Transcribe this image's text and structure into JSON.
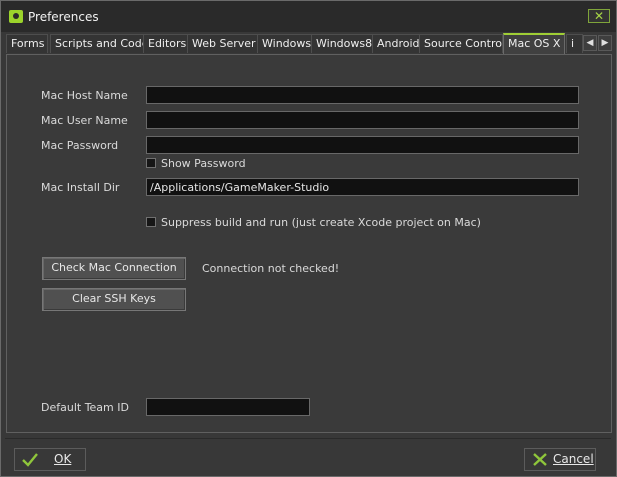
{
  "window": {
    "title": "Preferences",
    "close_glyph": "✕"
  },
  "tabs": [
    {
      "label": "Forms"
    },
    {
      "label": "Scripts and Code"
    },
    {
      "label": "Editors"
    },
    {
      "label": "Web Server"
    },
    {
      "label": "Windows"
    },
    {
      "label": "Windows8"
    },
    {
      "label": "Android"
    },
    {
      "label": "Source Control"
    },
    {
      "label": "Mac OS X"
    },
    {
      "label": "i"
    }
  ],
  "active_tab": "Mac OS X",
  "tab_scroll": {
    "left": "◀",
    "right": "▶"
  },
  "form": {
    "host_label": "Mac Host Name",
    "host_value": "",
    "user_label": "Mac User Name",
    "user_value": "",
    "password_label": "Mac Password",
    "password_value": "",
    "show_password_label": "Show Password",
    "show_password_checked": false,
    "install_dir_label": "Mac Install Dir",
    "install_dir_value": "/Applications/GameMaker-Studio",
    "suppress_label": "Suppress build and run (just create Xcode project on Mac)",
    "suppress_checked": false,
    "check_connection_label": "Check Mac Connection",
    "connection_status": "Connection not checked!",
    "clear_ssh_label": "Clear SSH Keys",
    "team_id_label": "Default Team ID",
    "team_id_value": ""
  },
  "footer": {
    "ok_label": "OK",
    "cancel_label": "Cancel"
  },
  "colors": {
    "accent": "#9fce35",
    "cancel_x": "#8fc63b"
  }
}
